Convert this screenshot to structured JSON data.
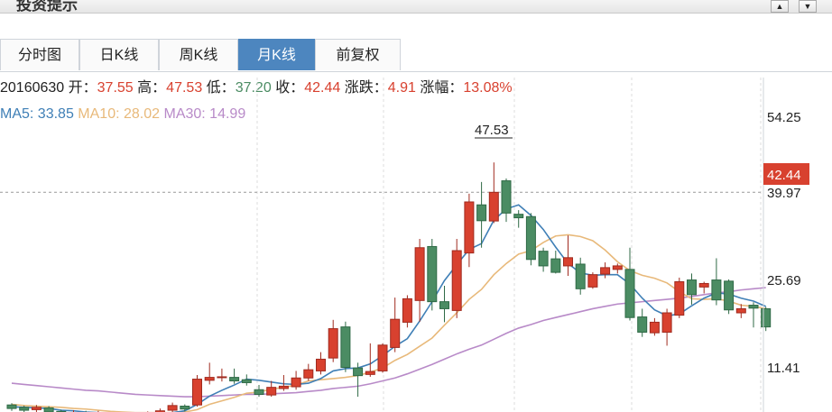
{
  "window": {
    "title": "投资提示",
    "scroll_up_icon": "triangle-up-icon",
    "scroll_down_icon": "triangle-down-icon"
  },
  "tabs": [
    {
      "label": "分时图",
      "active": false
    },
    {
      "label": "日K线",
      "active": false
    },
    {
      "label": "周K线",
      "active": false
    },
    {
      "label": "月K线",
      "active": true
    },
    {
      "label": "前复权",
      "active": false
    }
  ],
  "info": {
    "date": "20160630",
    "open_label": "开：",
    "open": "37.55",
    "high_label": "高：",
    "high": "47.53",
    "low_label": "低：",
    "low": "37.20",
    "close_label": "收：",
    "close": "42.44",
    "change_label": "涨跌：",
    "change": "4.91",
    "pct_label": "涨幅：",
    "pct": "13.08%"
  },
  "ma": {
    "ma5_label": "MA5: ",
    "ma5": "33.85",
    "ma10_label": "MA10: ",
    "ma10": "28.02",
    "ma30_label": "MA30: ",
    "ma30": "14.99"
  },
  "colors": {
    "up": "#d8412f",
    "down": "#4b8c63",
    "ma5": "#3f7fb6",
    "ma10": "#e8b97a",
    "ma30": "#b88ac8",
    "price_tag": "#d8412f",
    "tab_active": "#4d86bf"
  },
  "chart_data": {
    "type": "candlestick",
    "y_ticks": [
      "54.25",
      "39.97",
      "25.69",
      "11.41"
    ],
    "current_price_tag": "42.44",
    "peak_label": "47.53",
    "ylim": [
      5.0,
      62.0
    ],
    "grid": true,
    "legend": "top-left",
    "candles": [
      {
        "o": 6.2,
        "c": 5.6,
        "h": 6.5,
        "l": 5.2
      },
      {
        "o": 5.8,
        "c": 5.3,
        "h": 6.1,
        "l": 4.9
      },
      {
        "o": 5.4,
        "c": 5.8,
        "h": 6.2,
        "l": 5.0
      },
      {
        "o": 5.7,
        "c": 5.0,
        "h": 6.0,
        "l": 4.6
      },
      {
        "o": 5.1,
        "c": 4.5,
        "h": 5.4,
        "l": 4.1
      },
      {
        "o": 4.6,
        "c": 4.9,
        "h": 5.3,
        "l": 4.2
      },
      {
        "o": 4.9,
        "c": 4.4,
        "h": 5.2,
        "l": 4.0
      },
      {
        "o": 4.4,
        "c": 4.8,
        "h": 5.2,
        "l": 4.1
      },
      {
        "o": 4.8,
        "c": 4.3,
        "h": 5.0,
        "l": 3.9
      },
      {
        "o": 4.3,
        "c": 4.6,
        "h": 5.0,
        "l": 4.0
      },
      {
        "o": 4.6,
        "c": 4.2,
        "h": 4.9,
        "l": 3.8
      },
      {
        "o": 4.2,
        "c": 4.7,
        "h": 5.1,
        "l": 3.9
      },
      {
        "o": 4.7,
        "c": 5.2,
        "h": 5.6,
        "l": 4.4
      },
      {
        "o": 5.3,
        "c": 6.1,
        "h": 6.6,
        "l": 4.9
      },
      {
        "o": 6.0,
        "c": 5.5,
        "h": 6.3,
        "l": 5.1
      },
      {
        "o": 6.2,
        "c": 10.6,
        "h": 11.3,
        "l": 5.9
      },
      {
        "o": 10.4,
        "c": 10.9,
        "h": 13.4,
        "l": 9.7
      },
      {
        "o": 10.9,
        "c": 11.0,
        "h": 12.4,
        "l": 10.2
      },
      {
        "o": 10.9,
        "c": 10.3,
        "h": 12.4,
        "l": 9.8
      },
      {
        "o": 10.5,
        "c": 10.0,
        "h": 11.4,
        "l": 9.5
      },
      {
        "o": 8.8,
        "c": 8.0,
        "h": 9.6,
        "l": 7.6
      },
      {
        "o": 7.9,
        "c": 9.2,
        "h": 10.3,
        "l": 7.6
      },
      {
        "o": 9.0,
        "c": 9.4,
        "h": 11.3,
        "l": 8.6
      },
      {
        "o": 9.3,
        "c": 10.8,
        "h": 12.0,
        "l": 8.8
      },
      {
        "o": 10.8,
        "c": 12.2,
        "h": 13.2,
        "l": 10.3
      },
      {
        "o": 12.0,
        "c": 14.0,
        "h": 15.2,
        "l": 11.4
      },
      {
        "o": 14.2,
        "c": 19.2,
        "h": 20.7,
        "l": 13.5
      },
      {
        "o": 19.5,
        "c": 12.6,
        "h": 20.4,
        "l": 11.8
      },
      {
        "o": 12.5,
        "c": 11.2,
        "h": 13.4,
        "l": 7.6
      },
      {
        "o": 11.4,
        "c": 11.9,
        "h": 16.7,
        "l": 11.0
      },
      {
        "o": 12.0,
        "c": 16.4,
        "h": 16.7,
        "l": 11.7
      },
      {
        "o": 16.0,
        "c": 20.8,
        "h": 24.5,
        "l": 15.2
      },
      {
        "o": 20.3,
        "c": 24.3,
        "h": 24.9,
        "l": 19.4
      },
      {
        "o": 24.0,
        "c": 33.0,
        "h": 34.5,
        "l": 20.4
      },
      {
        "o": 33.2,
        "c": 23.8,
        "h": 34.5,
        "l": 22.3
      },
      {
        "o": 23.8,
        "c": 22.6,
        "h": 26.5,
        "l": 20.3
      },
      {
        "o": 22.3,
        "c": 32.5,
        "h": 34.5,
        "l": 21.0
      },
      {
        "o": 32.1,
        "c": 40.8,
        "h": 42.2,
        "l": 29.7
      },
      {
        "o": 40.3,
        "c": 37.6,
        "h": 44.2,
        "l": 33.0
      },
      {
        "o": 37.55,
        "c": 42.44,
        "h": 47.53,
        "l": 37.2
      }
    ],
    "candles_right": [
      {
        "o": 44.4,
        "c": 38.9,
        "h": 44.8,
        "l": 37.4
      },
      {
        "o": 38.7,
        "c": 38.1,
        "h": 39.4,
        "l": 36.4
      },
      {
        "o": 38.3,
        "c": 31.0,
        "h": 38.9,
        "l": 30.0
      },
      {
        "o": 32.4,
        "c": 29.9,
        "h": 33.0,
        "l": 28.9
      },
      {
        "o": 31.1,
        "c": 28.8,
        "h": 32.5,
        "l": 28.6
      },
      {
        "o": 29.9,
        "c": 31.3,
        "h": 35.1,
        "l": 28.2
      },
      {
        "o": 30.2,
        "c": 26.0,
        "h": 31.3,
        "l": 25.0
      },
      {
        "o": 26.3,
        "c": 28.4,
        "h": 28.8,
        "l": 26.0
      },
      {
        "o": 28.5,
        "c": 29.6,
        "h": 30.5,
        "l": 27.8
      },
      {
        "o": 29.3,
        "c": 29.9,
        "h": 30.3,
        "l": 28.6
      },
      {
        "o": 29.3,
        "c": 21.1,
        "h": 33.0,
        "l": 20.6
      },
      {
        "o": 21.2,
        "c": 18.6,
        "h": 22.6,
        "l": 17.8
      },
      {
        "o": 18.5,
        "c": 20.3,
        "h": 21.0,
        "l": 18.0
      },
      {
        "o": 18.6,
        "c": 21.9,
        "h": 22.6,
        "l": 16.3
      },
      {
        "o": 21.5,
        "c": 27.2,
        "h": 27.9,
        "l": 21.0
      },
      {
        "o": 27.5,
        "c": 25.0,
        "h": 28.6,
        "l": 23.3
      },
      {
        "o": 26.3,
        "c": 26.9,
        "h": 27.2,
        "l": 25.2
      },
      {
        "o": 27.5,
        "c": 24.1,
        "h": 31.2,
        "l": 23.2
      },
      {
        "o": 27.3,
        "c": 22.4,
        "h": 27.6,
        "l": 21.7
      },
      {
        "o": 21.9,
        "c": 22.6,
        "h": 23.4,
        "l": 21.0
      },
      {
        "o": 23.2,
        "c": 22.7,
        "h": 23.7,
        "l": 19.4
      },
      {
        "o": 22.6,
        "c": 19.5,
        "h": 22.9,
        "l": 18.8
      }
    ],
    "ma5": [
      5.9,
      5.8,
      5.7,
      5.6,
      5.3,
      5.2,
      5.0,
      4.9,
      4.7,
      4.6,
      4.5,
      4.5,
      4.6,
      4.9,
      5.2,
      6.3,
      7.7,
      8.7,
      9.6,
      10.6,
      10.4,
      10.1,
      9.8,
      9.7,
      9.9,
      10.7,
      12.0,
      12.4,
      12.5,
      13.2,
      14.6,
      16.2,
      17.5,
      20.5,
      23.8,
      27.4,
      30.1,
      32.7,
      33.7,
      37.7,
      39.6,
      40.3,
      38.5,
      36.1,
      33.1,
      30.3,
      28.7,
      28.3,
      28.4,
      28.4,
      26.8,
      24.4,
      22.4,
      21.4,
      21.7,
      23.1,
      24.4,
      25.3,
      25.1,
      24.4,
      23.9,
      23.0
    ],
    "ma10": [
      6.3,
      6.1,
      6.0,
      5.9,
      5.8,
      5.6,
      5.5,
      5.3,
      5.1,
      5.0,
      4.9,
      4.9,
      4.9,
      4.9,
      5.0,
      5.4,
      6.3,
      6.9,
      7.5,
      8.2,
      8.4,
      8.9,
      9.2,
      9.6,
      10.3,
      10.5,
      10.7,
      10.9,
      11.2,
      11.8,
      12.5,
      13.8,
      14.8,
      16.2,
      17.6,
      19.8,
      21.9,
      24.2,
      25.9,
      28.4,
      30.3,
      31.9,
      32.5,
      33.9,
      35.0,
      35.2,
      34.9,
      34.2,
      32.6,
      30.6,
      29.1,
      28.3,
      27.8,
      27.0,
      25.5,
      24.3,
      24.2,
      24.3,
      23.9,
      23.2,
      23.0,
      22.6
    ],
    "ma30": [
      9.9,
      9.7,
      9.5,
      9.3,
      9.1,
      8.9,
      8.7,
      8.6,
      8.4,
      8.2,
      8.0,
      7.9,
      7.8,
      7.7,
      7.6,
      7.6,
      7.7,
      7.8,
      7.9,
      8.0,
      8.0,
      8.1,
      8.2,
      8.3,
      8.5,
      8.7,
      9.0,
      9.2,
      9.4,
      9.8,
      10.3,
      10.8,
      11.5,
      12.3,
      13.1,
      14.0,
      14.9,
      15.7,
      16.4,
      17.4,
      18.4,
      19.3,
      19.9,
      20.6,
      21.1,
      21.6,
      22.1,
      22.6,
      23.0,
      23.4,
      23.6,
      23.8,
      24.0,
      24.2,
      24.4,
      24.7,
      25.0,
      25.3,
      25.5,
      25.8,
      26.0,
      26.2
    ]
  }
}
